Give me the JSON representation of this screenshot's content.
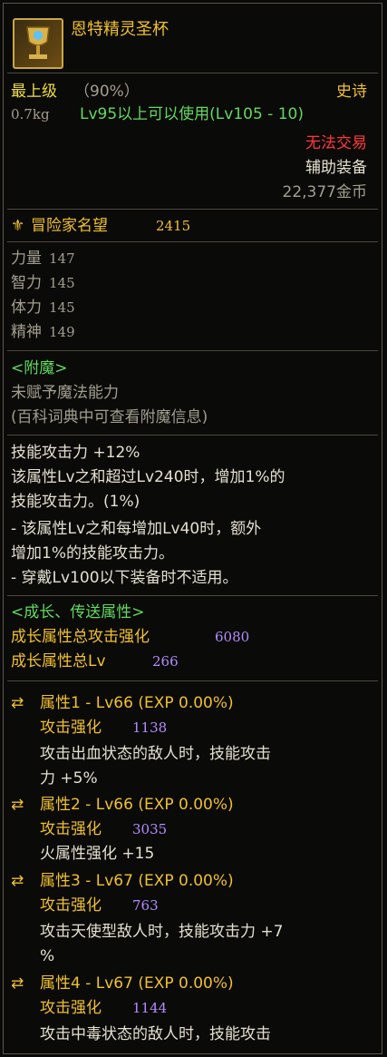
{
  "item": {
    "name": "恩特精灵圣杯",
    "grade": "最上级",
    "grade_pct": "（90%）",
    "rarity": "史诗",
    "weight": "0.7kg",
    "level_req": "Lv95以上可以使用(Lv105 - 10)",
    "trade": "无法交易",
    "type": "辅助装备",
    "price": "22,377金币",
    "fame_label": "冒险家名望",
    "fame_value": "2415"
  },
  "stats": [
    {
      "label": "力量",
      "value": "147"
    },
    {
      "label": "智力",
      "value": "145"
    },
    {
      "label": "体力",
      "value": "145"
    },
    {
      "label": "精神",
      "value": "149"
    }
  ],
  "enchant": {
    "header": "<附魔>",
    "none": "未赋予魔法能力",
    "hint": "(百科词典中可查看附魔信息)"
  },
  "skill": {
    "line1": "技能攻击力 +12%",
    "line2": "该属性Lv之和超过Lv240时，增加1%的",
    "line3": "技能攻击力。(1%)",
    "line4": "- 该属性Lv之和每增加Lv40时，额外",
    "line5": "增加1%的技能攻击力。",
    "line6": "- 穿戴Lv100以下装备时不适用。"
  },
  "growth": {
    "header": "<成长、传送属性>",
    "total_atk_label": "成长属性总攻击强化",
    "total_atk_value": "6080",
    "total_lv_label": "成长属性总Lv",
    "total_lv_value": "266",
    "attrs": [
      {
        "title": "属性1 - Lv66 (EXP 0.00%)",
        "atk_label": "攻击强化",
        "atk_value": "1138",
        "effect1": "攻击出血状态的敌人时，技能攻击",
        "effect2": "力 +5%"
      },
      {
        "title": "属性2 - Lv66 (EXP 0.00%)",
        "atk_label": "攻击强化",
        "atk_value": "3035",
        "effect1": "火属性强化 +15",
        "effect2": ""
      },
      {
        "title": "属性3 - Lv67 (EXP 0.00%)",
        "atk_label": "攻击强化",
        "atk_value": "763",
        "effect1": "攻击天使型敌人时，技能攻击力 +7",
        "effect2": "%"
      },
      {
        "title": "属性4 - Lv67 (EXP 0.00%)",
        "atk_label": "攻击强化",
        "atk_value": "1144",
        "effect1": "攻击中毒状态的敌人时，技能攻击",
        "effect2": ""
      }
    ]
  },
  "colors": {
    "gold": "#f0c030",
    "green": "#62d95e",
    "red": "#ff3838",
    "purple": "#b48cff",
    "border": "#5c574c"
  },
  "icons": [
    "chalice-icon",
    "fame-icon",
    "shuffle-icon"
  ]
}
